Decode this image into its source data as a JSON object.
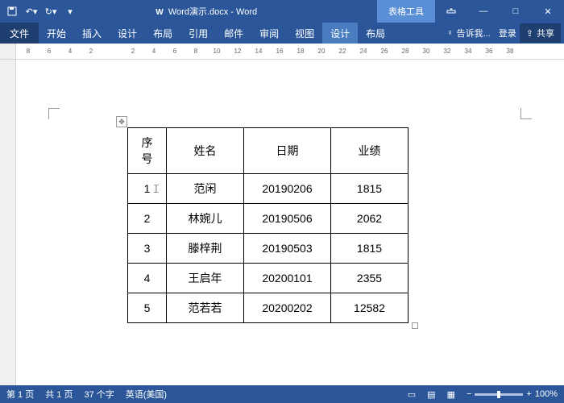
{
  "colors": {
    "accent": "#2b579a"
  },
  "titlebar": {
    "doc": "Word演示.docx - Word",
    "context_tab": "表格工具"
  },
  "win": {
    "min": "—",
    "max": "□",
    "close": "✕",
    "restore": "▢"
  },
  "ribbon": {
    "file": "文件",
    "tabs": [
      "开始",
      "插入",
      "设计",
      "布局",
      "引用",
      "邮件",
      "审阅",
      "视图"
    ],
    "tool_tabs": [
      "设计",
      "布局"
    ],
    "tell_me": "告诉我...",
    "login": "登录",
    "share": "共享"
  },
  "ruler": [
    "8",
    "6",
    "4",
    "2",
    "",
    "2",
    "4",
    "6",
    "8",
    "10",
    "12",
    "14",
    "16",
    "18",
    "20",
    "22",
    "24",
    "26",
    "28",
    "30",
    "32",
    "34",
    "36",
    "38"
  ],
  "chart_data": {
    "type": "table",
    "headers": [
      "序号",
      "姓名",
      "日期",
      "业绩"
    ],
    "rows": [
      [
        "1",
        "范闲",
        "20190206",
        "1815"
      ],
      [
        "2",
        "林婉儿",
        "20190506",
        "2062"
      ],
      [
        "3",
        "滕梓荆",
        "20190503",
        "1815"
      ],
      [
        "4",
        "王启年",
        "20200101",
        "2355"
      ],
      [
        "5",
        "范若若",
        "20200202",
        "12582"
      ]
    ]
  },
  "status": {
    "page": "第 1 页",
    "total": "共 1 页",
    "words": "37 个字",
    "lang": "英语(美国)",
    "zoom": "100%"
  }
}
